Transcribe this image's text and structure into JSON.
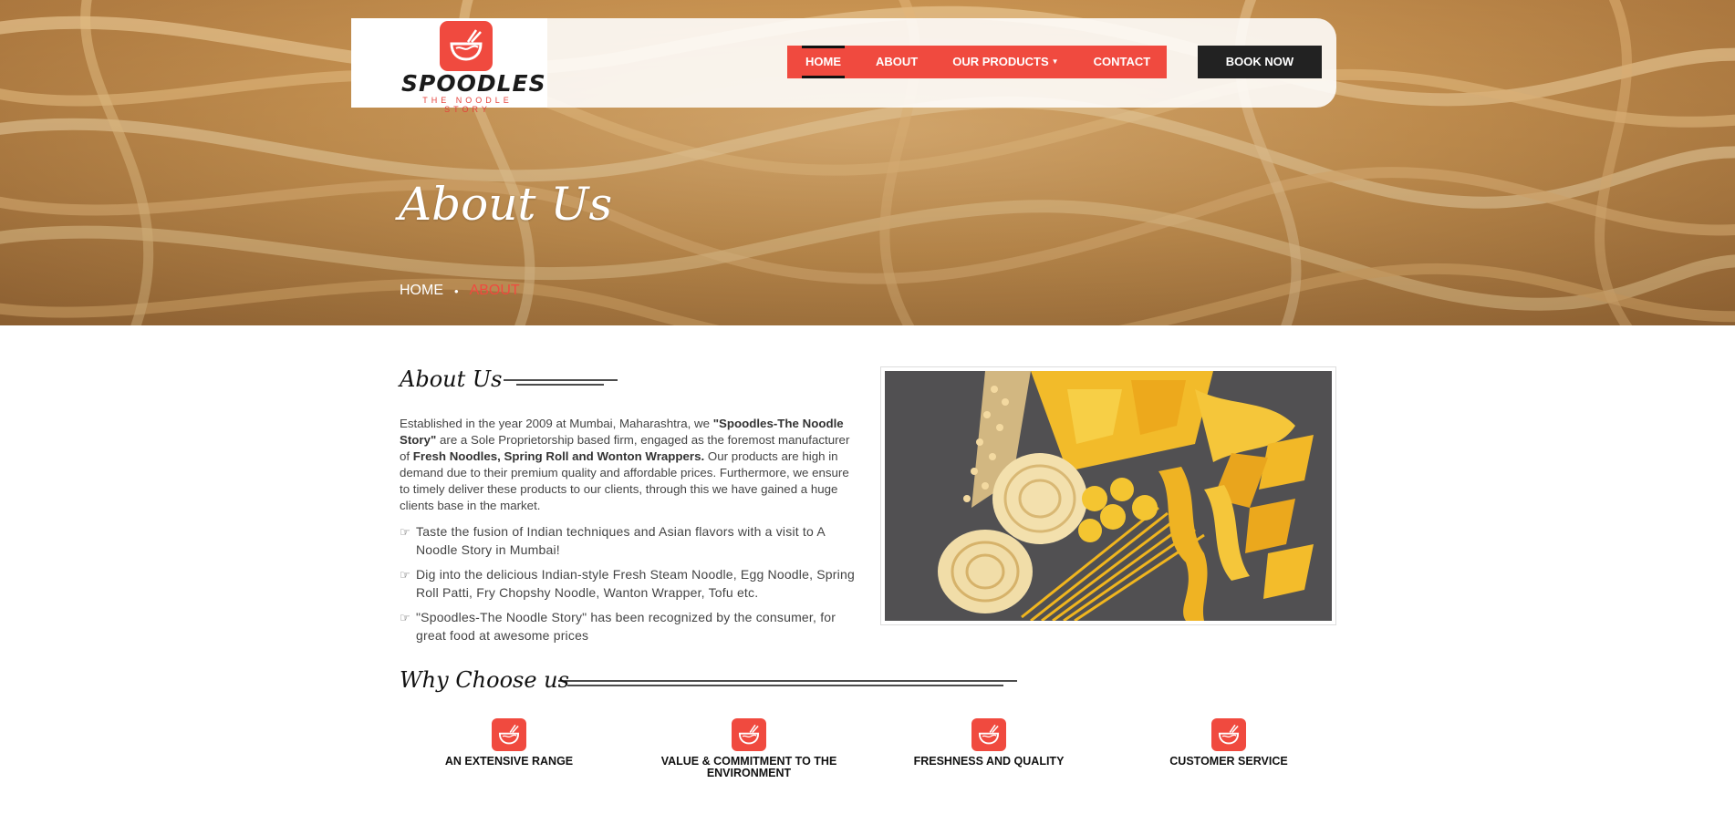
{
  "brand": {
    "name": "SPOODLES",
    "tagline": "THE NOODLE STORY",
    "accent": "#f04a3f"
  },
  "nav": {
    "items": [
      {
        "label": "HOME",
        "active": true
      },
      {
        "label": "ABOUT",
        "active": false
      },
      {
        "label": "OUR PRODUCTS",
        "active": false,
        "has_dropdown": true
      },
      {
        "label": "CONTACT",
        "active": false
      }
    ],
    "book_label": "BOOK NOW"
  },
  "hero": {
    "title": "About Us",
    "breadcrumb": {
      "home": "HOME",
      "current": "ABOUT"
    }
  },
  "about": {
    "title": "About Us",
    "para": {
      "p1": "Established in the year 2009 at Mumbai, Maharashtra, we ",
      "b1": "\"Spoodles-The Noodle Story\"",
      "p2": " are a Sole Proprietorship based firm, engaged as the foremost manufacturer of ",
      "b2": "Fresh Noodles, Spring Roll and Wonton Wrappers.",
      "p3": " Our products are high in demand due to their premium quality and affordable prices. Furthermore, we ensure to timely deliver these products to our clients, through this we have gained a huge clients base in the market."
    },
    "bullets": [
      "Taste the fusion of Indian techniques and Asian flavors with a visit to A Noodle Story in Mumbai!",
      "Dig into the delicious Indian-style Fresh Steam Noodle, Egg Noodle, Spring Roll Patti, Fry Chopshy Noodle, Wanton Wrapper, Tofu etc.",
      "\"Spoodles-The Noodle Story\" has been recognized by the consumer, for great food at awesome prices"
    ]
  },
  "why": {
    "title": "Why Choose us",
    "features": [
      {
        "label": "AN EXTENSIVE RANGE",
        "icon": "noodle-bowl-icon"
      },
      {
        "label": "VALUE & COMMITMENT TO THE ENVIRONMENT",
        "icon": "noodle-bowl-icon"
      },
      {
        "label": "FRESHNESS AND QUALITY",
        "icon": "noodle-bowl-icon"
      },
      {
        "label": "CUSTOMER SERVICE",
        "icon": "noodle-bowl-icon"
      }
    ]
  }
}
